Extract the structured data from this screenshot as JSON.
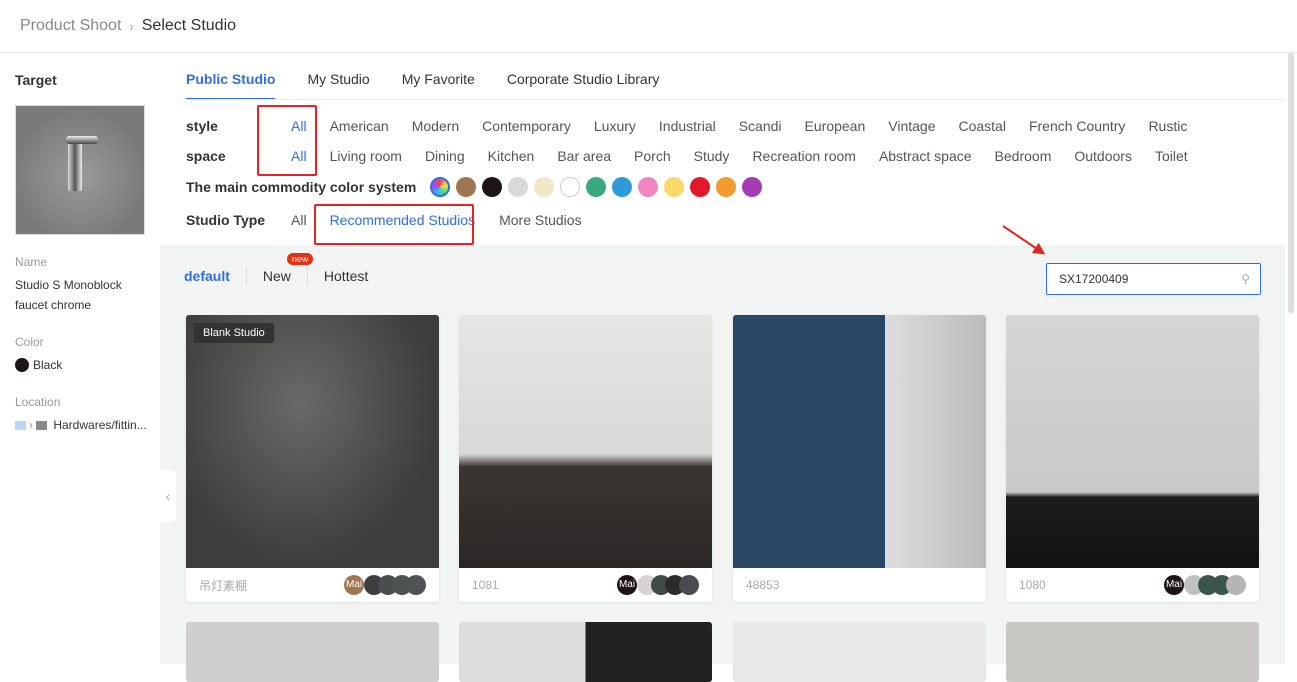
{
  "breadcrumb": {
    "parent": "Product Shoot",
    "current": "Select Studio"
  },
  "target": {
    "title": "Target",
    "name_label": "Name",
    "name": "Studio S Monoblock faucet chrome",
    "color_label": "Color",
    "color": "Black",
    "color_hex": "#1e1418",
    "location_label": "Location",
    "location": "Hardwares/fittin..."
  },
  "tabs": [
    "Public Studio",
    "My Studio",
    "My Favorite",
    "Corporate Studio Library"
  ],
  "filters": {
    "style_label": "style",
    "style": [
      "All",
      "American",
      "Modern",
      "Contemporary",
      "Luxury",
      "Industrial",
      "Scandi",
      "European",
      "Vintage",
      "Coastal",
      "French Country",
      "Rustic"
    ],
    "space_label": "space",
    "space": [
      "All",
      "Living room",
      "Dining",
      "Kitchen",
      "Bar area",
      "Porch",
      "Study",
      "Recreation room",
      "Abstract space",
      "Bedroom",
      "Outdoors",
      "Toilet"
    ],
    "color_label": "The main commodity color system",
    "colors": [
      "#a07552",
      "#1e1418",
      "#d9d9d9",
      "#f0e6c8",
      "#ffffff",
      "#3aaa7e",
      "#2f9ad8",
      "#ef86bf",
      "#f8d96a",
      "#e2192a",
      "#f19a2e",
      "#a43bb4"
    ],
    "type_label": "Studio Type",
    "types": [
      "All",
      "Recommended Studios",
      "More Studios"
    ]
  },
  "sort": {
    "default": "default",
    "new": "New",
    "new_badge": "new",
    "hottest": "Hottest"
  },
  "search": {
    "value": "SX17200409"
  },
  "cards": [
    {
      "name": "吊灯素棚",
      "badge": "Blank Studio",
      "main": "Mai",
      "main_color": "#a07552",
      "colors": [
        "#3d3f3f",
        "#4a4e50",
        "#4f5252",
        "#505354"
      ]
    },
    {
      "name": "1081",
      "main": "Mai",
      "main_color": "#1e1418",
      "colors": [
        "#d4d4d4",
        "#3f4b44",
        "#2b2b2b",
        "#4b4b4d"
      ]
    },
    {
      "name": "48853"
    },
    {
      "name": "1080",
      "main": "Mai",
      "main_color": "#1e1418",
      "colors": [
        "#c0c0c0",
        "#3d564c",
        "#3d564c",
        "#b5b5b5"
      ]
    }
  ]
}
